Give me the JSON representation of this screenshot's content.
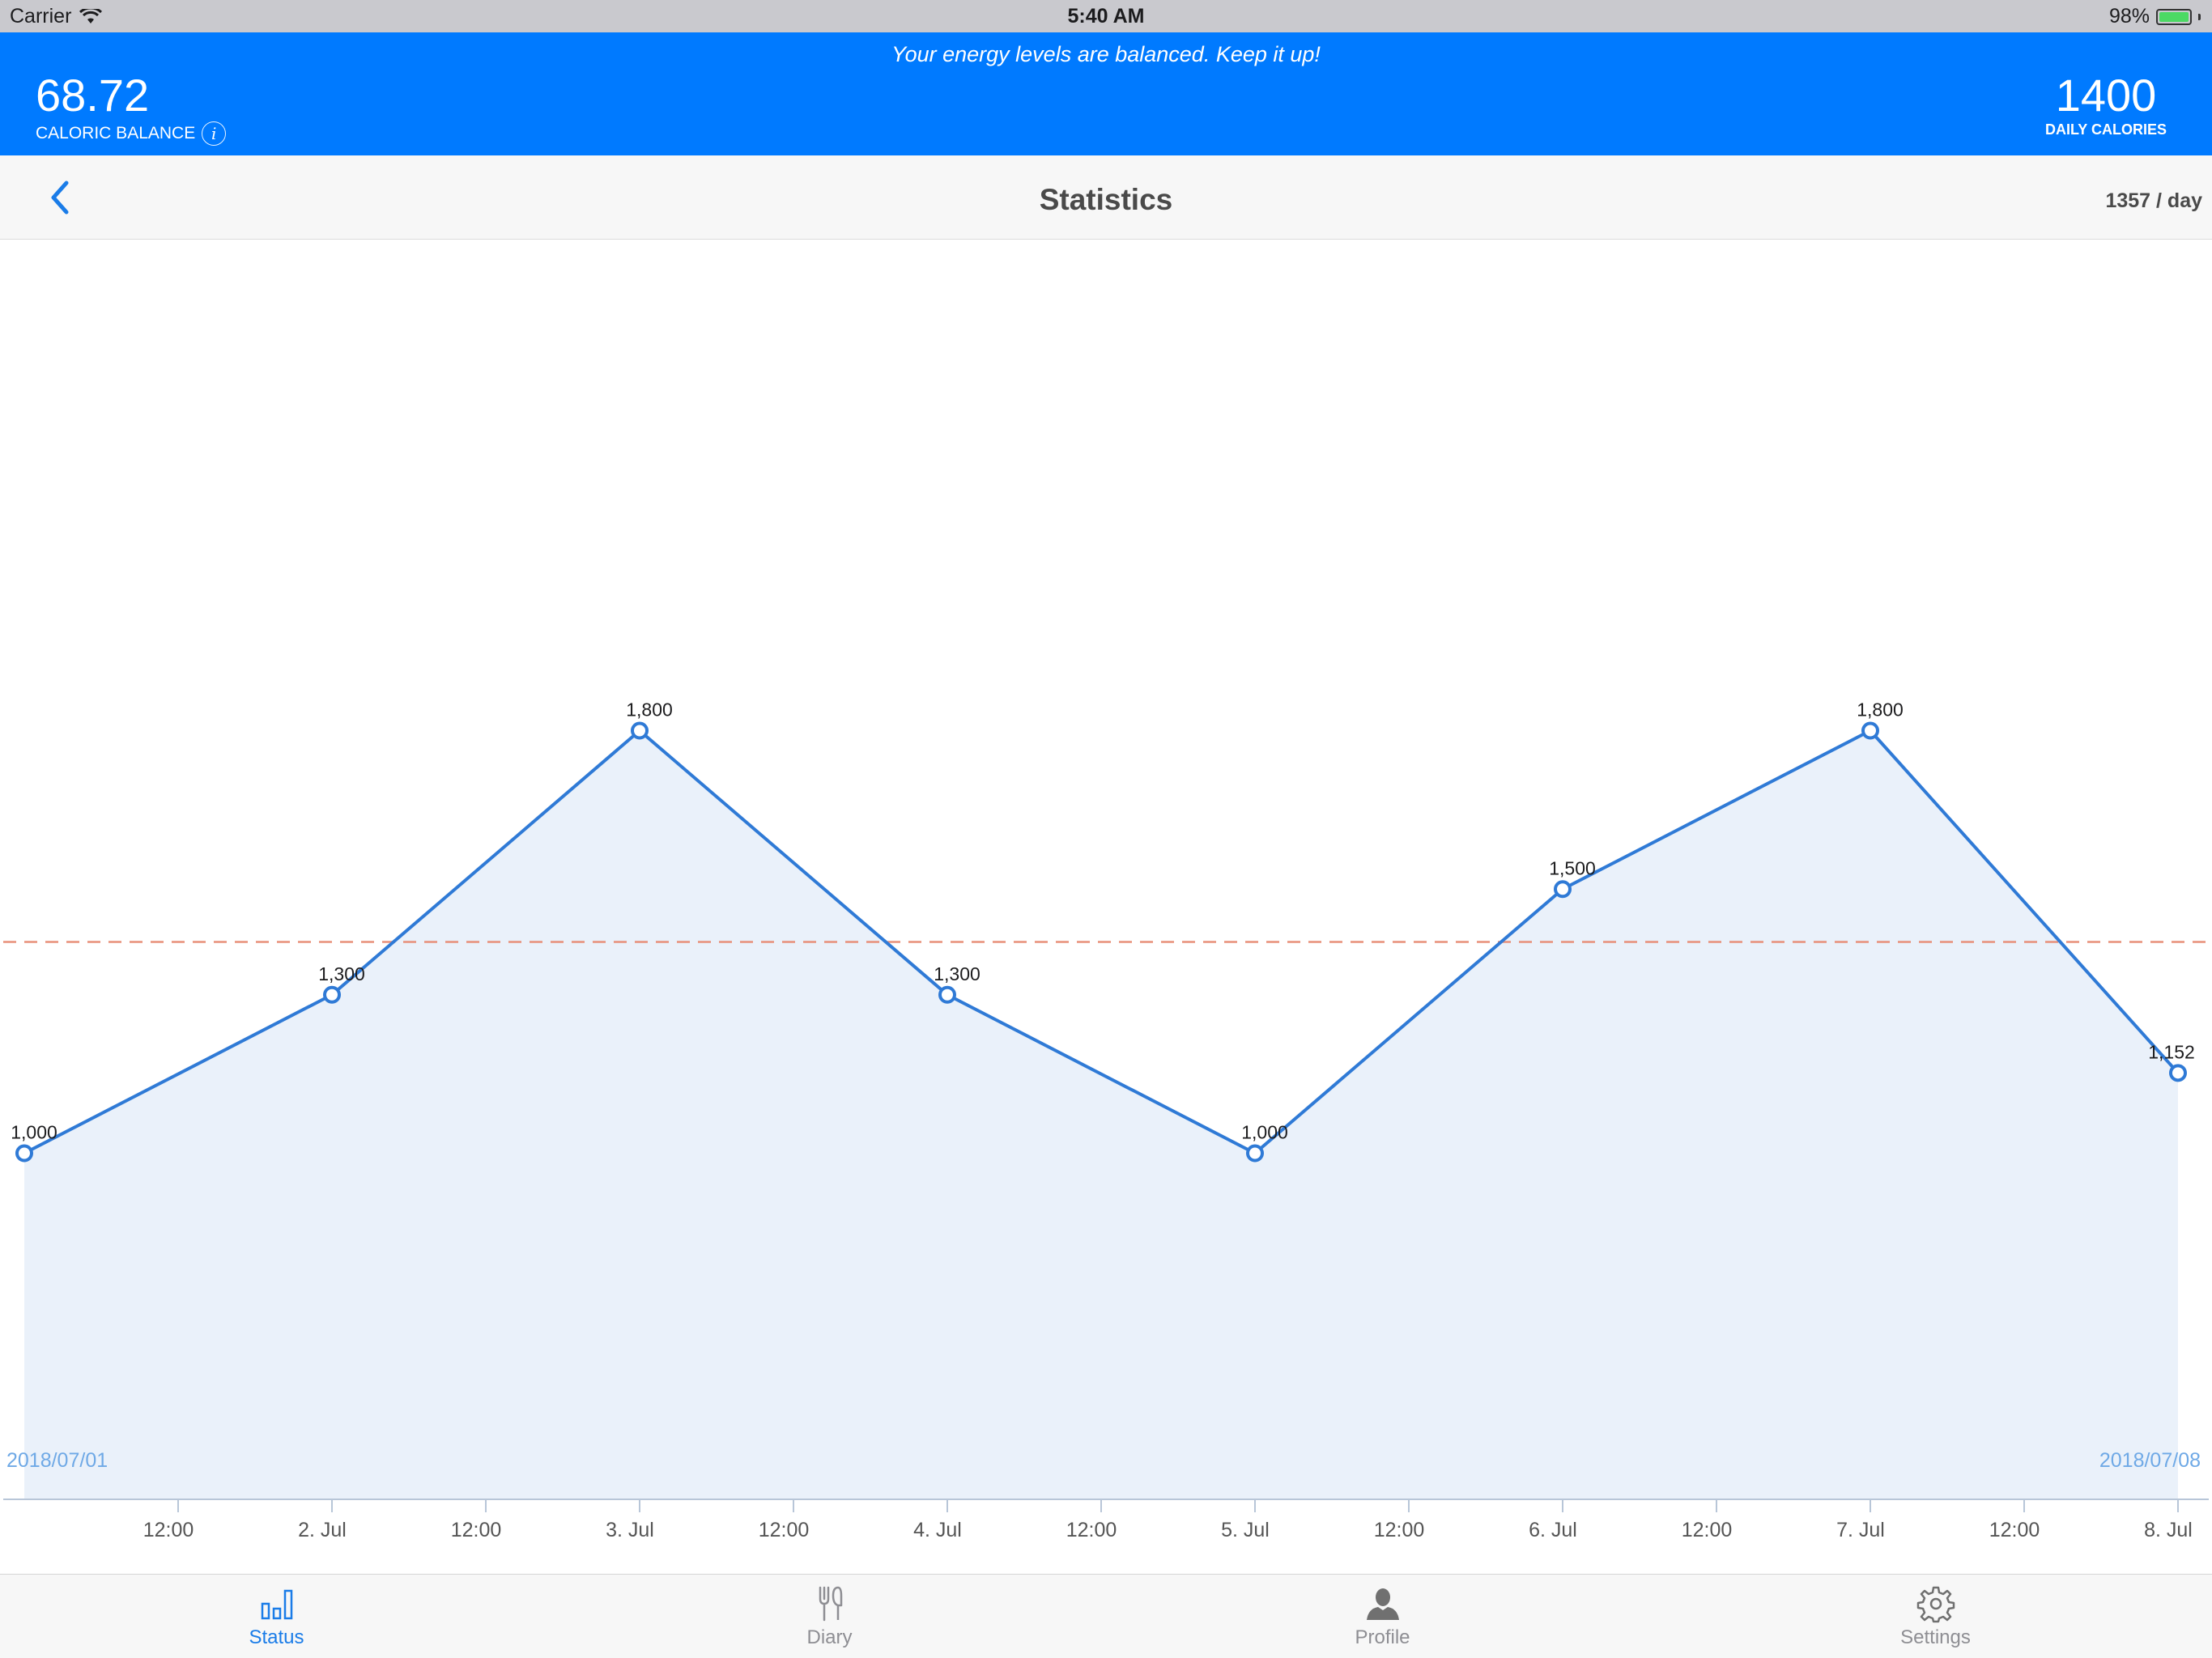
{
  "status_bar": {
    "carrier": "Carrier",
    "time": "5:40 AM",
    "battery": "98%"
  },
  "header": {
    "message": "Your energy levels are balanced. Keep it up!",
    "caloric_balance_value": "68.72",
    "caloric_balance_label": "CALORIC BALANCE",
    "daily_calories_value": "1400",
    "daily_calories_label": "DAILY CALORIES"
  },
  "navbar": {
    "title": "Statistics",
    "right_text": "1357 / day"
  },
  "chart_data": {
    "type": "area",
    "x": [
      "2018-07-01 12:00",
      "2018-07-02 12:00",
      "2018-07-03 12:00",
      "2018-07-04 12:00",
      "2018-07-05 12:00",
      "2018-07-06 12:00",
      "2018-07-07 12:00",
      "2018-07-08 12:00"
    ],
    "values": [
      1000,
      1300,
      1800,
      1300,
      1000,
      1500,
      1800,
      1152
    ],
    "data_labels": [
      "1,000",
      "1,300",
      "1,800",
      "1,300",
      "1,000",
      "1,500",
      "1,800",
      "1,152"
    ],
    "x_tick_labels": [
      "12:00",
      "2. Jul",
      "12:00",
      "3. Jul",
      "12:00",
      "4. Jul",
      "12:00",
      "5. Jul",
      "12:00",
      "6. Jul",
      "12:00",
      "7. Jul",
      "12:00",
      "8. Jul"
    ],
    "reference_line": 1400,
    "start_label": "2018/07/01",
    "end_label": "2018/07/08",
    "ylim": [
      0,
      2000
    ],
    "line_color": "#2f7ad6",
    "fill_color": "#eaf1fa",
    "reference_color": "#e8907a",
    "grid": false
  },
  "tabs": [
    {
      "label": "Status",
      "icon": "bar-chart-icon",
      "active": true
    },
    {
      "label": "Diary",
      "icon": "fork-knife-icon",
      "active": false
    },
    {
      "label": "Profile",
      "icon": "person-icon",
      "active": false
    },
    {
      "label": "Settings",
      "icon": "gear-icon",
      "active": false
    }
  ],
  "colors": {
    "header_blue": "#007aff",
    "accent": "#1a7ce8"
  }
}
